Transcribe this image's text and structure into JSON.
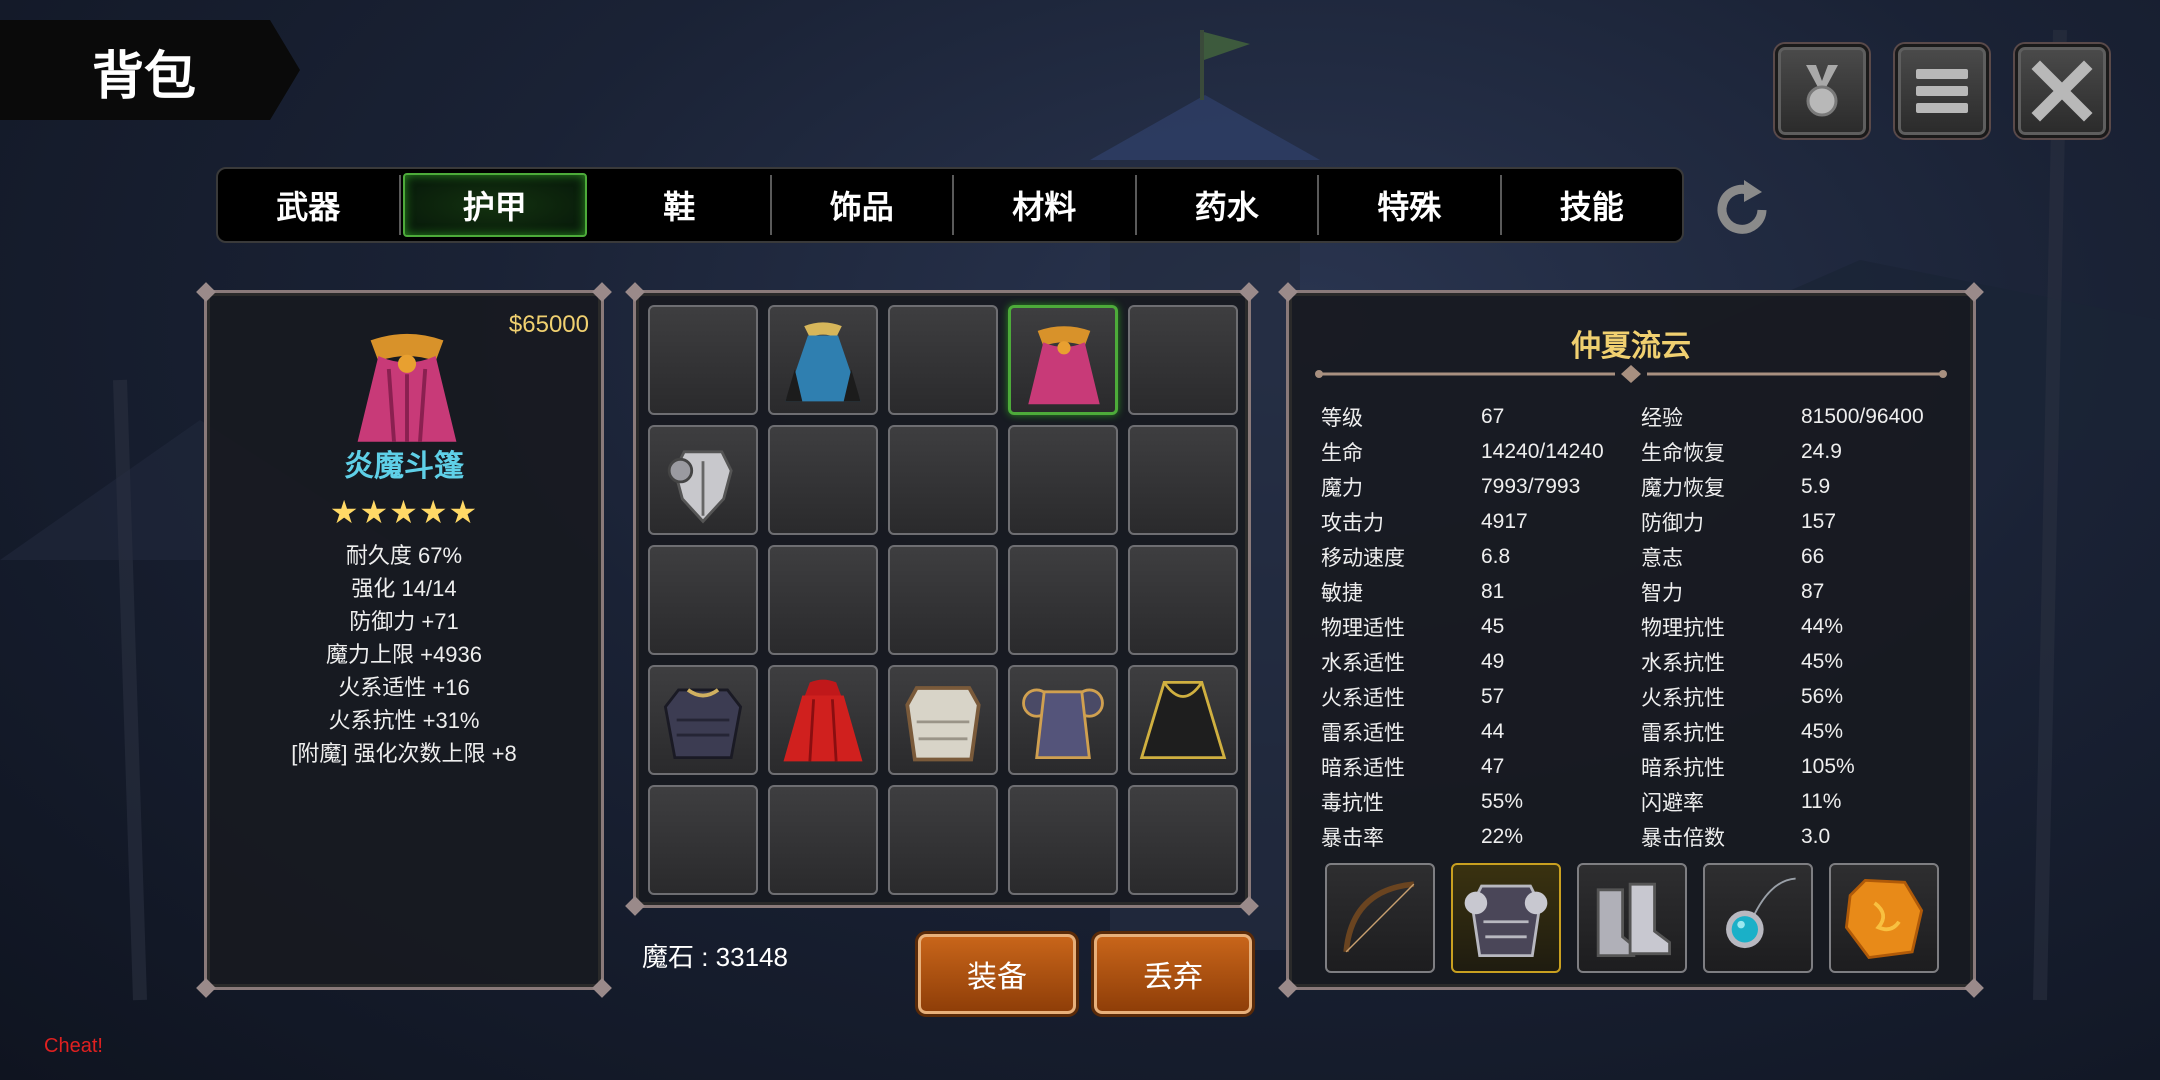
{
  "header": {
    "title": "背包"
  },
  "top_buttons": [
    {
      "name": "achievement-medal-icon"
    },
    {
      "name": "menu-icon"
    },
    {
      "name": "close-icon"
    }
  ],
  "tabs": [
    {
      "label": "武器"
    },
    {
      "label": "护甲",
      "active": true
    },
    {
      "label": "鞋"
    },
    {
      "label": "饰品"
    },
    {
      "label": "材料"
    },
    {
      "label": "药水"
    },
    {
      "label": "特殊"
    },
    {
      "label": "技能"
    }
  ],
  "selected_item": {
    "price": "$65000",
    "name": "炎魔斗篷",
    "stars": "★★★★★",
    "star_count": 5,
    "stats": [
      "耐久度 67%",
      "强化 14/14",
      "防御力  +71",
      "魔力上限  +4936",
      "火系适性  +16",
      "火系抗性  +31%",
      "[附魔] 强化次数上限 +8"
    ]
  },
  "inventory": {
    "slots": [
      "",
      "blue-robe-icon",
      "",
      "demon-cloak-icon",
      "",
      "steel-chestplate-icon",
      "",
      "",
      "",
      "",
      "",
      "",
      "",
      "",
      "",
      "dark-plate-armor-icon",
      "red-cape-icon",
      "silver-cuirass-icon",
      "shadow-armor-icon",
      "black-coat-icon",
      "",
      "",
      "",
      "",
      ""
    ],
    "selected_index": 3
  },
  "magic_stone": "魔石 : 33148",
  "actions": {
    "equip": "装备",
    "discard": "丢弃"
  },
  "character": {
    "name": "仲夏流云",
    "stats": [
      [
        "等级",
        "67",
        "经验",
        "81500/96400"
      ],
      [
        "生命",
        "14240/14240",
        "生命恢复",
        "24.9"
      ],
      [
        "魔力",
        "7993/7993",
        "魔力恢复",
        "5.9"
      ],
      [
        "攻击力",
        "4917",
        "防御力",
        "157"
      ],
      [
        "移动速度",
        "6.8",
        "意志",
        "66"
      ],
      [
        "敏捷",
        "81",
        "智力",
        "87"
      ],
      [
        "物理适性",
        "45",
        "物理抗性",
        "44%"
      ],
      [
        "水系适性",
        "49",
        "水系抗性",
        "45%"
      ],
      [
        "火系适性",
        "57",
        "火系抗性",
        "56%"
      ],
      [
        "雷系适性",
        "44",
        "雷系抗性",
        "45%"
      ],
      [
        "暗系适性",
        "47",
        "暗系抗性",
        "105%"
      ],
      [
        "毒抗性",
        "55%",
        "闪避率",
        "11%"
      ],
      [
        "暴击率",
        "22%",
        "暴击倍数",
        "3.0"
      ]
    ],
    "equipment": [
      "bow-icon",
      "armor-icon",
      "boots-icon",
      "amulet-icon",
      "amber-gem-icon"
    ]
  },
  "cheat_label": "Cheat!",
  "colors": {
    "accent_green": "#4dab3a",
    "gold": "#f0d070",
    "item_name": "#5fd0e8",
    "button_orange": "#c8651a",
    "cheat_red": "#e02020"
  }
}
